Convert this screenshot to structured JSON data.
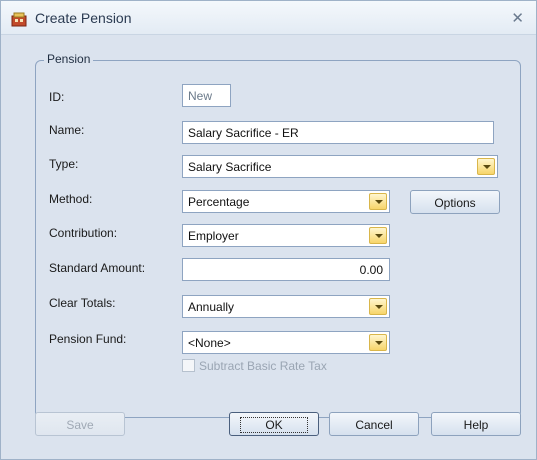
{
  "window": {
    "title": "Create Pension"
  },
  "group": {
    "legend": "Pension"
  },
  "fields": {
    "id": {
      "label": "ID:",
      "value": "New"
    },
    "name": {
      "label": "Name:",
      "value": "Salary Sacrifice - ER"
    },
    "type": {
      "label": "Type:",
      "value": "Salary Sacrifice"
    },
    "method": {
      "label": "Method:",
      "value": "Percentage"
    },
    "contribution": {
      "label": "Contribution:",
      "value": "Employer"
    },
    "standard_amount": {
      "label": "Standard Amount:",
      "value": "0.00"
    },
    "clear_totals": {
      "label": "Clear Totals:",
      "value": "Annually"
    },
    "pension_fund": {
      "label": "Pension Fund:",
      "value": "<None>"
    }
  },
  "options_button": "Options",
  "subtract_tax": {
    "label": "Subtract Basic Rate Tax",
    "checked": false,
    "enabled": false
  },
  "buttons": {
    "save": "Save",
    "ok": "OK",
    "cancel": "Cancel",
    "help": "Help"
  },
  "colors": {
    "accent": "#f7d56a",
    "background": "#dbe3ee",
    "border": "#8ea4c1"
  }
}
